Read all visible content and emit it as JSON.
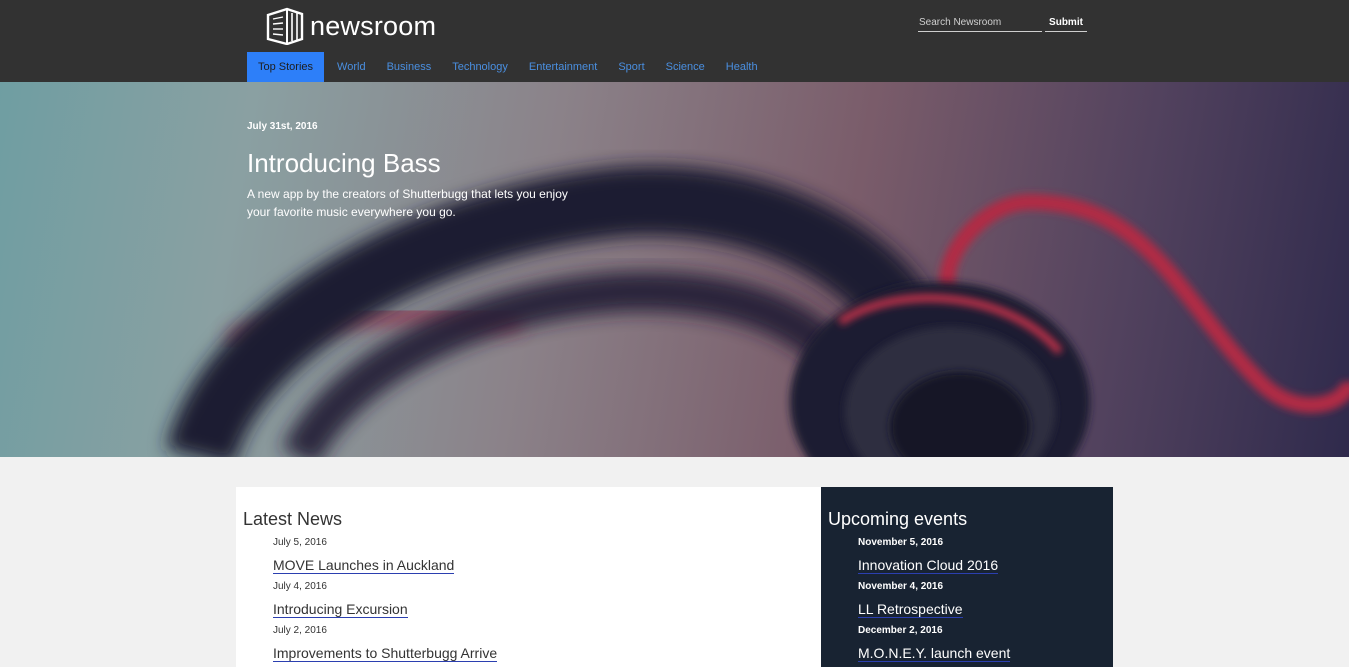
{
  "header": {
    "logo_text": "newsroom",
    "search_placeholder": "Search Newsroom",
    "submit_label": "Submit"
  },
  "nav": {
    "items": [
      "Top Stories",
      "World",
      "Business",
      "Technology",
      "Entertainment",
      "Sport",
      "Science",
      "Health"
    ],
    "active": "Top Stories"
  },
  "hero": {
    "date": "July 31st, 2016",
    "title": "Introducing Bass",
    "subtitle": "A new app by the creators of Shutterbugg that lets you enjoy your favorite music everywhere you go."
  },
  "latest_news": {
    "title": "Latest News",
    "items": [
      {
        "date": "July 5, 2016",
        "title": "MOVE Launches in Auckland"
      },
      {
        "date": "July 4, 2016",
        "title": "Introducing Excursion"
      },
      {
        "date": "July 2, 2016",
        "title": "Improvements to Shutterbugg Arrive"
      }
    ]
  },
  "upcoming_events": {
    "title": "Upcoming events",
    "items": [
      {
        "date": "November 5, 2016",
        "title": "Innovation Cloud 2016"
      },
      {
        "date": "November 4, 2016",
        "title": "LL Retrospective"
      },
      {
        "date": "December 2, 2016",
        "title": "M.O.N.E.Y. launch event"
      }
    ]
  },
  "colors": {
    "header_bg": "#323232",
    "nav_link": "#4a8fe0",
    "nav_active_bg": "#2d7ff9",
    "events_bg": "#182332",
    "page_bg": "#f1f1f1"
  }
}
